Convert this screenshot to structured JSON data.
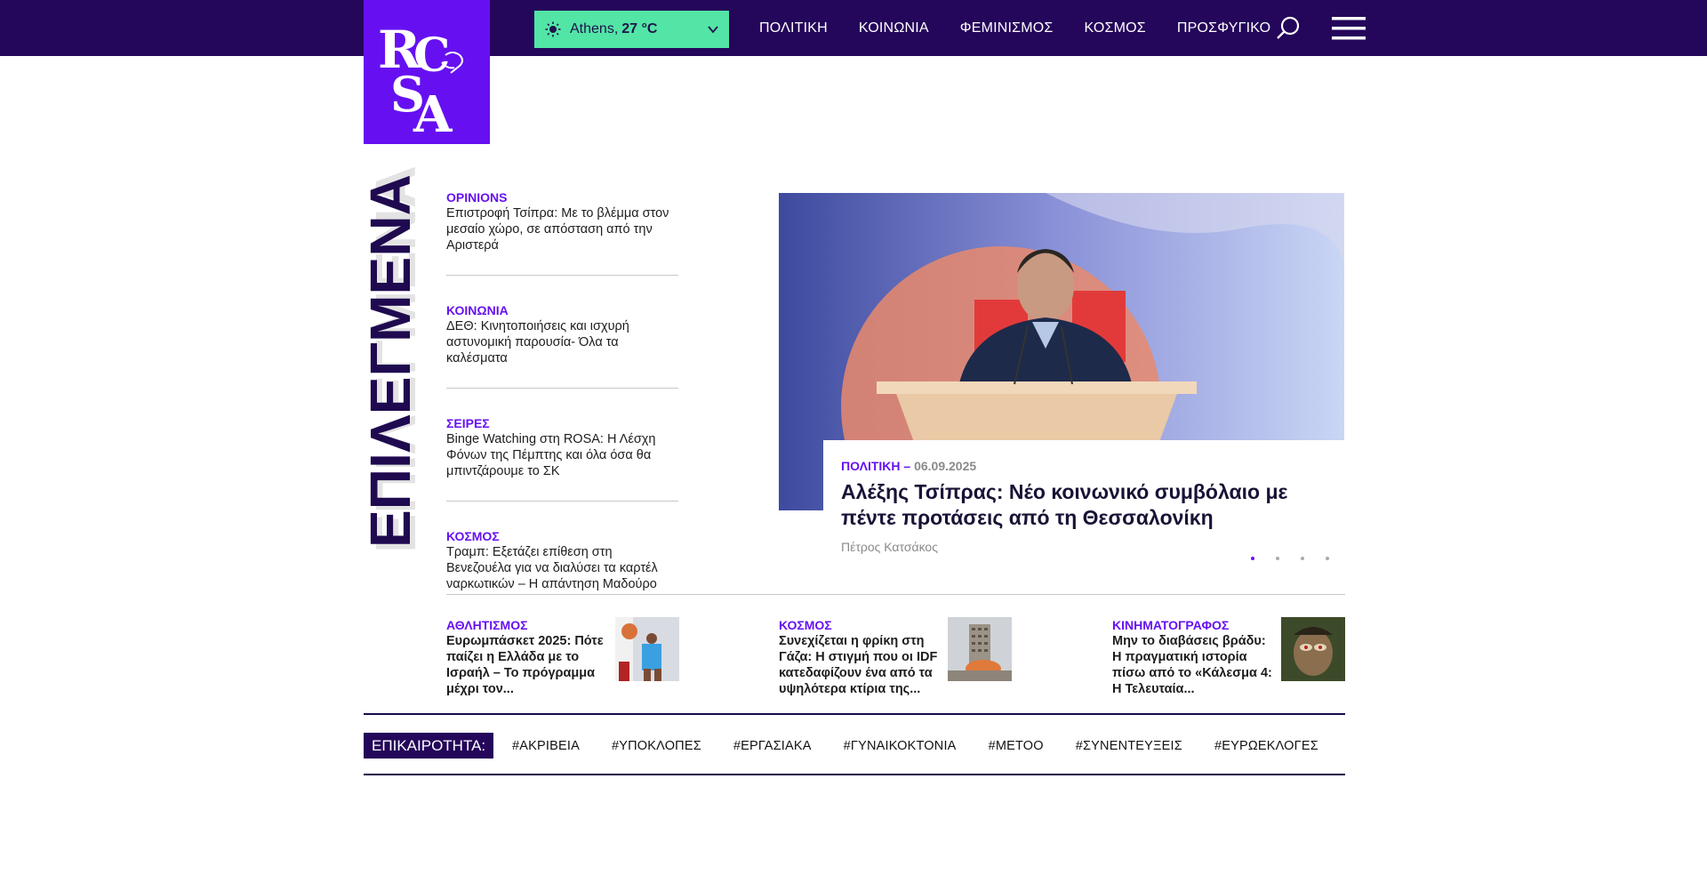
{
  "header": {
    "logo_text": "ROSA",
    "weather": {
      "city": "Athens,",
      "temp": "27 °C",
      "icon": "sun-icon"
    },
    "nav": [
      "ΠΟΛΙΤΙΚΗ",
      "ΚΟΙΝΩΝΙΑ",
      "ΦΕΜΙΝΙΣΜΟΣ",
      "ΚΟΣΜΟΣ",
      "ΠΡΟΣΦΥΓΙΚΟ"
    ],
    "colors": {
      "bar": "#24065a",
      "logo": "#6610f2",
      "weather": "#52e5a6"
    }
  },
  "featured": {
    "section_title": "ΕΠΙΛΕΓΜΕΝΑ",
    "items": [
      {
        "category": "OPINIONS",
        "title": "Επιστροφή Τσίπρα: Με το βλέμμα στον μεσαίο χώρο, σε απόσταση από την Αριστερά"
      },
      {
        "category": "ΚΟΙΝΩΝΙΑ",
        "title": "ΔΕΘ: Κινητοποιήσεις και ισχυρή αστυνομική παρουσία- Όλα τα καλέσματα"
      },
      {
        "category": "ΣΕΙΡΕΣ",
        "title": "Binge Watching στη ROSA: Η Λέσχη Φόνων της Πέμπτης και όλα όσα θα μπιντζάρουμε το ΣΚ"
      },
      {
        "category": "ΚΟΣΜΟΣ",
        "title": "Τραμπ: Εξετάζει επίθεση στη Βενεζουέλα για να διαλύσει τα καρτέλ ναρκωτικών – Η απάντηση Μαδούρο"
      }
    ]
  },
  "hero": {
    "category": "ΠΟΛΙΤΙΚΗ",
    "separator": "–",
    "date": "06.09.2025",
    "title": "Αλέξης Τσίπρας: Νέο κοινωνικό συμβόλαιο με πέντε προτάσεις από τη Θεσσαλονίκη",
    "author": "Πέτρος Κατσάκος",
    "slides_count": 4,
    "active_slide": 1
  },
  "small_articles": [
    {
      "category": "ΑΘΛΗΤΙΣΜΟΣ",
      "title": "Ευρωμπάσκετ 2025: Πότε παίζει η Ελλάδα με το Ισραήλ – Το πρόγραμμα μέχρι τον...",
      "thumb": "basketball-thumb"
    },
    {
      "category": "ΚΟΣΜΟΣ",
      "title": "Συνεχίζεται η φρίκη στη Γάζα: Η στιγμή που οι IDF κατεδαφίζουν ένα από τα υψηλότερα κτίρια της...",
      "thumb": "building-thumb"
    },
    {
      "category": "ΚΙΝΗΜΑΤΟΓΡΑΦΟΣ",
      "title": "Μην το διαβάσεις βράδυ: Η πραγματική ιστορία πίσω από το «Κάλεσμα 4: Η Τελευταία...",
      "thumb": "film-thumb"
    }
  ],
  "trending": {
    "label": "ΕΠΙΚΑΙΡΟΤΗΤΑ:",
    "tags": [
      "#ΑΚΡΙΒΕΙΑ",
      "#ΥΠΟΚΛΟΠΕΣ",
      "#ΕΡΓΑΣΙΑΚΑ",
      "#ΓΥΝΑΙΚΟΚΤΟΝΙΑ",
      "#ΜΕΤΟΟ",
      "#ΣΥΝΕΝΤΕΥΞΕΙΣ",
      "#ΕΥΡΩΕΚΛΟΓΕΣ"
    ]
  }
}
